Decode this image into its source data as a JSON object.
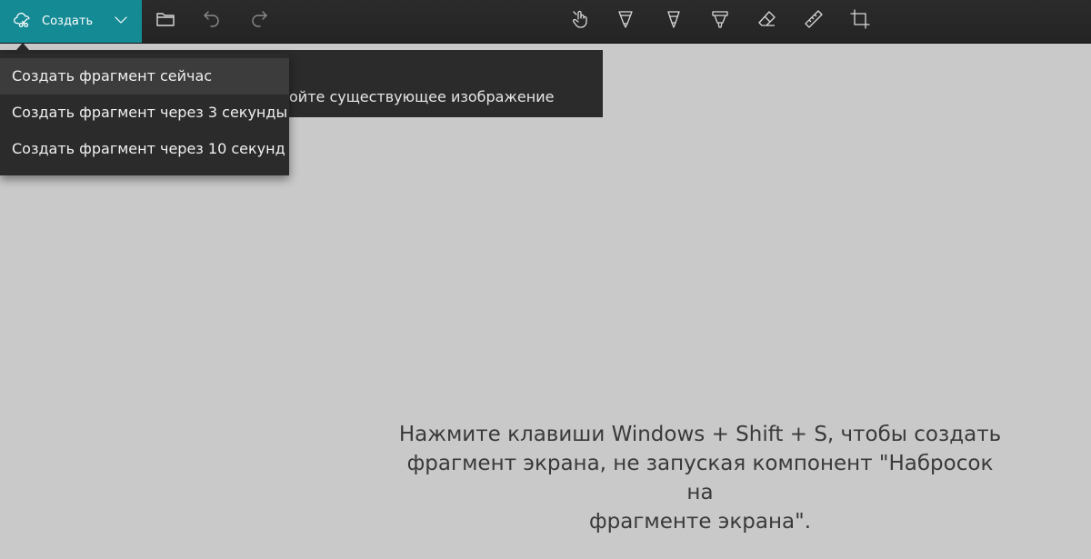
{
  "toolbar": {
    "create_label": "Создать",
    "icons": [
      "scissors-cloud-icon",
      "chevron-down-icon",
      "folder-icon",
      "undo-icon",
      "redo-icon",
      "touch-writing-icon",
      "ballpoint-pen-icon",
      "pencil-icon",
      "highlighter-icon",
      "eraser-icon",
      "ruler-icon",
      "crop-icon"
    ]
  },
  "tooltip": {
    "text": "ойте существующее изображение"
  },
  "dropdown": {
    "items": [
      {
        "label": "Создать фрагмент сейчас"
      },
      {
        "label": "Создать фрагмент через 3 секунды"
      },
      {
        "label": "Создать фрагмент через 10 секунд"
      }
    ]
  },
  "hint": {
    "line1": "Нажмите клавиши Windows + Shift + S, чтобы создать",
    "line2": "фрагмент экрана, не запуская компонент \"Набросок на",
    "line3": "фрагменте экрана\"."
  },
  "colors": {
    "accent": "#148a95",
    "toolbar_bg": "#2b2b2b",
    "canvas_bg": "#c9c9c9",
    "menu_bg": "#2b2b2b"
  }
}
